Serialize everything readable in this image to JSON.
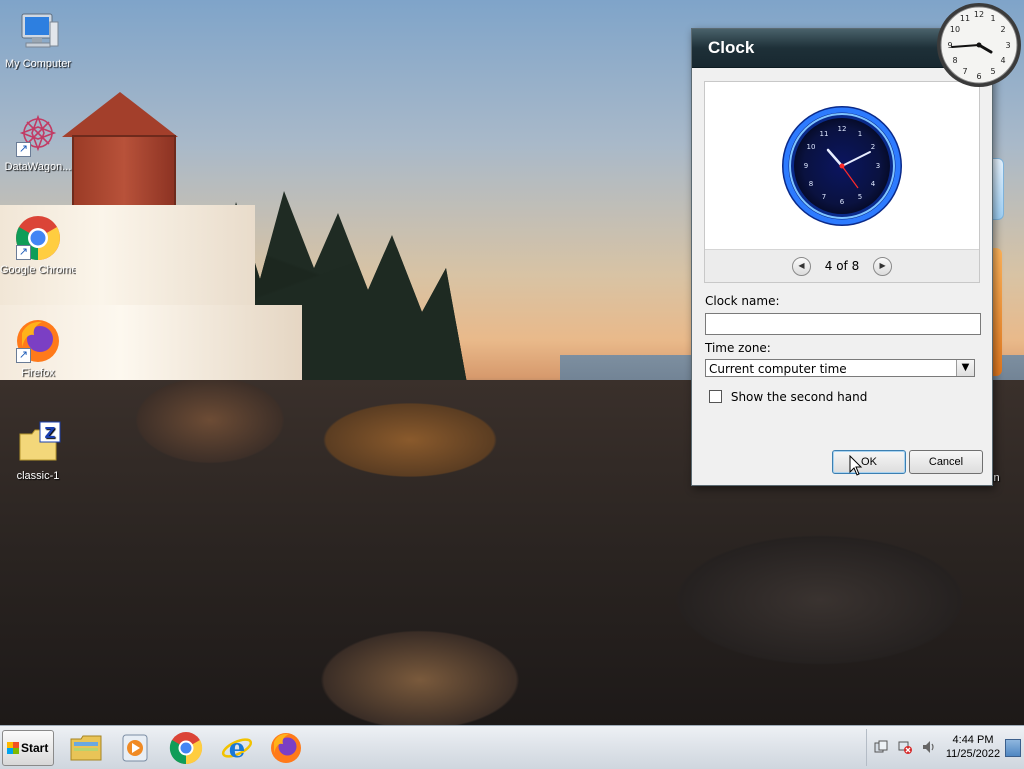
{
  "desktop": {
    "icons": [
      {
        "label": "My Computer",
        "icon": "computer-icon"
      },
      {
        "label": "DataWagon...",
        "icon": "datawagon-icon"
      },
      {
        "label": "Google Chrome",
        "icon": "chrome-icon"
      },
      {
        "label": "Firefox",
        "icon": "firefox-icon"
      },
      {
        "label": "classic-1",
        "icon": "zip-file-icon"
      }
    ],
    "partial_label": "in"
  },
  "dialog": {
    "title": "Clock",
    "pager": "4 of 8",
    "clock_name_label": "Clock name:",
    "clock_name_value": "",
    "time_zone_label": "Time zone:",
    "time_zone_value": "Current computer time",
    "show_second_hand_label": "Show the second hand",
    "show_second_hand_checked": false,
    "ok_label": "OK",
    "cancel_label": "Cancel"
  },
  "taskbar": {
    "start_label": "Start",
    "apps": [
      "file-explorer-icon",
      "media-player-icon",
      "chrome-icon",
      "internet-explorer-icon",
      "firefox-icon"
    ],
    "time": "4:44 PM",
    "date": "11/25/2022"
  },
  "colors": {
    "dialog_title_bg": "#1e3038",
    "neon_clock_blue": "#1d4cff",
    "taskbar_bg": "#dfe4ea"
  }
}
